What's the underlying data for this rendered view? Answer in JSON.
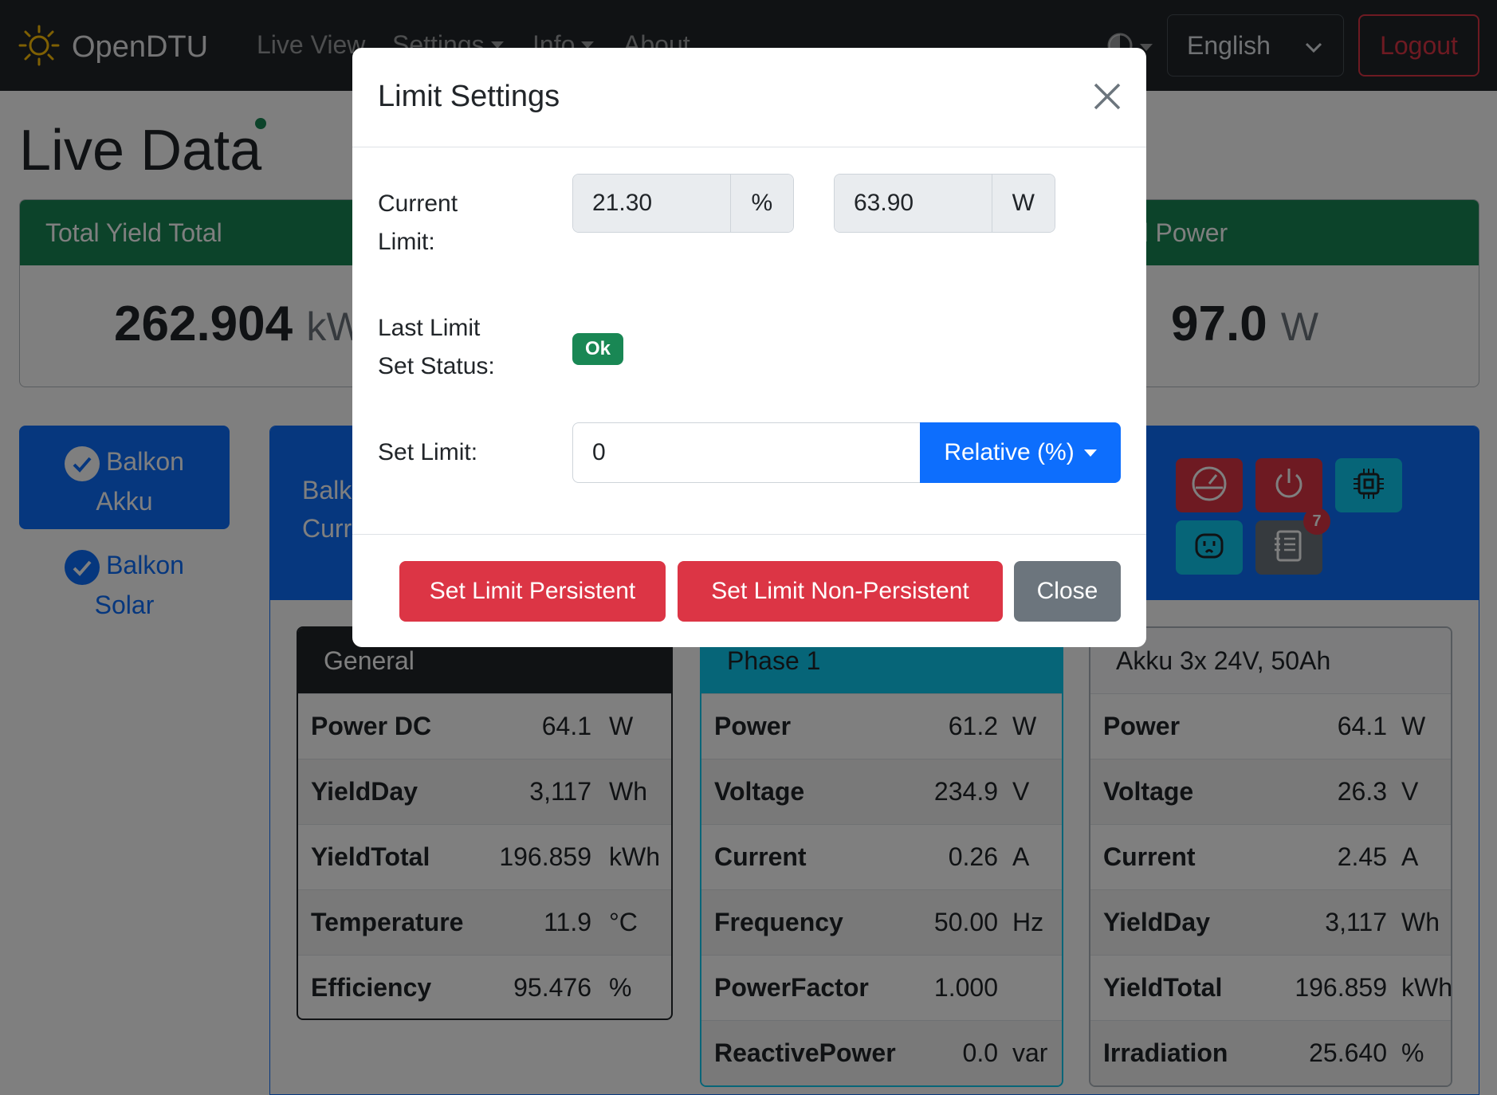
{
  "navbar": {
    "brand": "OpenDTU",
    "items": [
      "Live View",
      "Settings",
      "Info",
      "About"
    ],
    "language": "English",
    "logout": "Logout"
  },
  "page": {
    "title": "Live Data"
  },
  "totals": [
    {
      "label": "Total Yield Total",
      "value": "262.904",
      "unit": "kWh"
    },
    {
      "label": "Total Power",
      "value": "97.0",
      "unit": "W"
    }
  ],
  "inverters": [
    {
      "line1": "Balkon",
      "line2": "Akku"
    },
    {
      "line1": "Balkon",
      "line2": "Solar"
    }
  ],
  "inverter_panel": {
    "title_line1": "Balkon Akku",
    "title_line2": "Current Limit",
    "event_count": "7"
  },
  "tables": {
    "general": {
      "title": "General",
      "rows": [
        {
          "label": "Power DC",
          "value": "64.1",
          "unit": "W"
        },
        {
          "label": "YieldDay",
          "value": "3,117",
          "unit": "Wh"
        },
        {
          "label": "YieldTotal",
          "value": "196.859",
          "unit": "kWh"
        },
        {
          "label": "Temperature",
          "value": "11.9",
          "unit": "°C"
        },
        {
          "label": "Efficiency",
          "value": "95.476",
          "unit": "%"
        }
      ]
    },
    "phase1": {
      "title": "Phase 1",
      "rows": [
        {
          "label": "Power",
          "value": "61.2",
          "unit": "W"
        },
        {
          "label": "Voltage",
          "value": "234.9",
          "unit": "V"
        },
        {
          "label": "Current",
          "value": "0.26",
          "unit": "A"
        },
        {
          "label": "Frequency",
          "value": "50.00",
          "unit": "Hz"
        },
        {
          "label": "PowerFactor",
          "value": "1.000",
          "unit": ""
        },
        {
          "label": "ReactivePower",
          "value": "0.0",
          "unit": "var"
        }
      ]
    },
    "akku": {
      "title": "Akku 3x 24V, 50Ah",
      "rows": [
        {
          "label": "Power",
          "value": "64.1",
          "unit": "W"
        },
        {
          "label": "Voltage",
          "value": "26.3",
          "unit": "V"
        },
        {
          "label": "Current",
          "value": "2.45",
          "unit": "A"
        },
        {
          "label": "YieldDay",
          "value": "3,117",
          "unit": "Wh"
        },
        {
          "label": "YieldTotal",
          "value": "196.859",
          "unit": "kWh"
        },
        {
          "label": "Irradiation",
          "value": "25.640",
          "unit": "%"
        }
      ]
    }
  },
  "modal": {
    "title": "Limit Settings",
    "current_limit_label_1": "Current",
    "current_limit_label_2": "Limit:",
    "current_limit_percent": "21.30",
    "percent_unit": "%",
    "current_limit_watt": "63.90",
    "watt_unit": "W",
    "last_status_label_1": "Last Limit",
    "last_status_label_2": "Set Status:",
    "last_status_value": "Ok",
    "set_limit_label": "Set Limit:",
    "set_limit_value": "0",
    "set_limit_type": "Relative (%)",
    "btn_persistent": "Set Limit Persistent",
    "btn_non_persistent": "Set Limit Non-Persistent",
    "btn_close": "Close"
  },
  "colors": {
    "primary": "#0d6efd",
    "success": "#198754",
    "danger": "#dc3545",
    "info": "#0dcaf0",
    "secondary": "#6c757d",
    "dark": "#212529"
  }
}
